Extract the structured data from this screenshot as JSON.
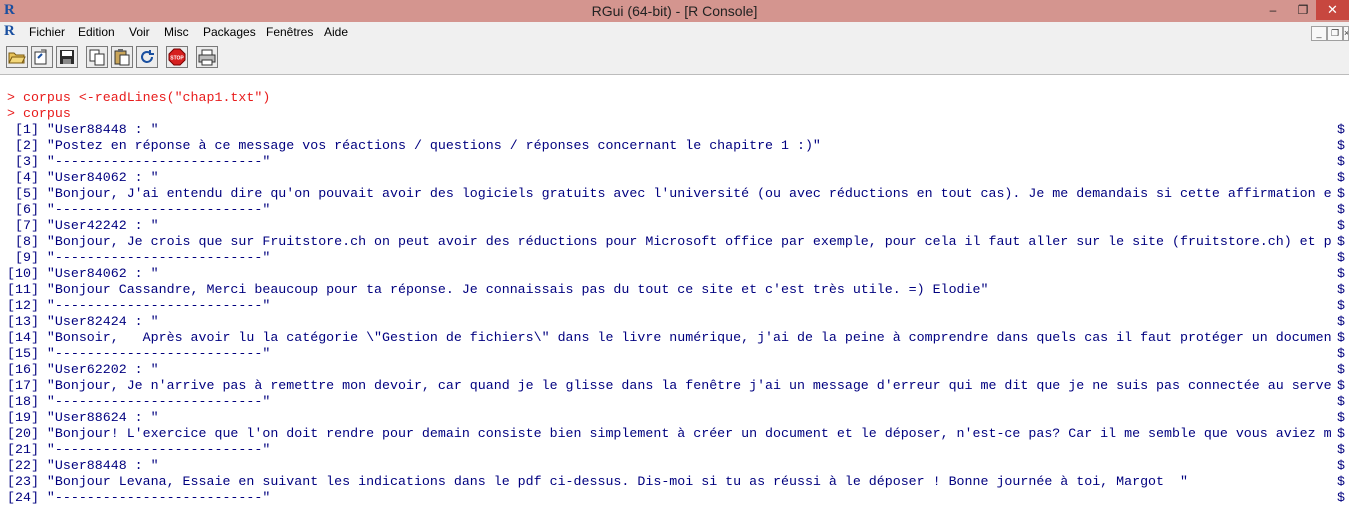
{
  "window": {
    "title": "RGui (64-bit) - [R Console]",
    "min_glyph": "–",
    "max_glyph": "❐",
    "close_glyph": "✕",
    "logo": "R"
  },
  "menubar": {
    "r_icon": "R",
    "items": [
      "Fichier",
      "Edition",
      "Voir",
      "Misc",
      "Packages",
      "Fenêtres",
      "Aide"
    ],
    "mdi_min": "_",
    "mdi_restore": "❐",
    "mdi_close": "×"
  },
  "toolbar": {
    "buttons": [
      "open-script",
      "load-workspace",
      "save-workspace",
      "copy",
      "paste",
      "copy-paste",
      "stop",
      "print"
    ],
    "stop_label": "STOP"
  },
  "console": {
    "commands": [
      "> corpus <-readLines(\"chap1.txt\")",
      "> corpus"
    ],
    "output": [
      " [1] \"User88448 : \"",
      " [2] \"Postez en réponse à ce message vos réactions / questions / réponses concernant le chapitre 1 :)\"",
      " [3] \"--------------------------\"",
      " [4] \"User84062 : \"",
      " [5] \"Bonjour, J'ai entendu dire qu'on pouvait avoir des logiciels gratuits avec l'université (ou avec réductions en tout cas). Je me demandais si cette affirmation e",
      " [6] \"--------------------------\"",
      " [7] \"User42242 : \"",
      " [8] \"Bonjour, Je crois que sur Fruitstore.ch on peut avoir des réductions pour Microsoft office par exemple, pour cela il faut aller sur le site (fruitstore.ch) et p",
      " [9] \"--------------------------\"",
      "[10] \"User84062 : \"",
      "[11] \"Bonjour Cassandre, Merci beaucoup pour ta réponse. Je connaissais pas du tout ce site et c'est très utile. =) Elodie\"",
      "[12] \"--------------------------\"",
      "[13] \"User82424 : \"",
      "[14] \"Bonsoir,   Après avoir lu la catégorie \\\"Gestion de fichiers\\\" dans le livre numérique, j'ai de la peine à comprendre dans quels cas il faut protéger un documen",
      "[15] \"--------------------------\"",
      "[16] \"User62202 : \"",
      "[17] \"Bonjour, Je n'arrive pas à remettre mon devoir, car quand je le glisse dans la fenêtre j'ai un message d'erreur qui me dit que je ne suis pas connectée au serve",
      "[18] \"--------------------------\"",
      "[19] \"User88624 : \"",
      "[20] \"Bonjour! L'exercice que l'on doit rendre pour demain consiste bien simplement à créer un document et le déposer, n'est-ce pas? Car il me semble que vous aviez m",
      "[21] \"--------------------------\"",
      "[22] \"User88448 : \"",
      "[23] \"Bonjour Levana, Essaie en suivant les indications dans le pdf ci-dessus. Dis-moi si tu as réussi à le déposer ! Bonne journée à toi, Margot  \"",
      "[24] \"--------------------------\""
    ],
    "truncation_mark": "$",
    "colors": {
      "command": "#e81b1b",
      "output": "#00007f"
    }
  }
}
